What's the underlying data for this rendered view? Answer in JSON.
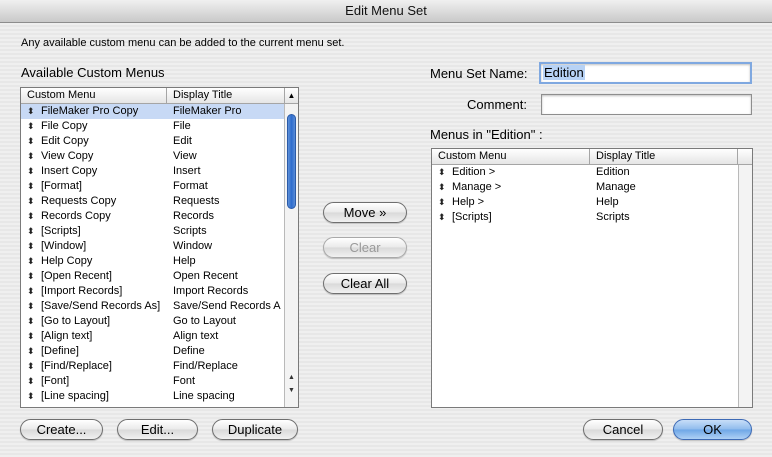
{
  "window": {
    "title": "Edit Menu Set"
  },
  "intro_text": "Any available custom menu can be added to the current menu set.",
  "available": {
    "heading": "Available Custom Menus",
    "columns": [
      "Custom Menu",
      "Display Title"
    ],
    "sort_indicator": "▲",
    "rows": [
      {
        "menu": "FileMaker Pro Copy",
        "title": "FileMaker Pro",
        "selected": true
      },
      {
        "menu": "File Copy",
        "title": "File"
      },
      {
        "menu": "Edit Copy",
        "title": "Edit"
      },
      {
        "menu": "View Copy",
        "title": "View"
      },
      {
        "menu": "Insert Copy",
        "title": "Insert"
      },
      {
        "menu": "[Format]",
        "title": "Format"
      },
      {
        "menu": "Requests Copy",
        "title": "Requests"
      },
      {
        "menu": "Records Copy",
        "title": "Records"
      },
      {
        "menu": "[Scripts]",
        "title": "Scripts"
      },
      {
        "menu": "[Window]",
        "title": "Window"
      },
      {
        "menu": "Help Copy",
        "title": "Help"
      },
      {
        "menu": "[Open Recent]",
        "title": "Open Recent"
      },
      {
        "menu": "[Import Records]",
        "title": "Import Records"
      },
      {
        "menu": "[Save/Send Records As]",
        "title": "Save/Send Records A"
      },
      {
        "menu": "[Go to Layout]",
        "title": "Go to Layout"
      },
      {
        "menu": "[Align text]",
        "title": "Align text"
      },
      {
        "menu": "[Define]",
        "title": "Define"
      },
      {
        "menu": "[Find/Replace]",
        "title": "Find/Replace"
      },
      {
        "menu": "[Font]",
        "title": "Font"
      },
      {
        "menu": "[Line spacing]",
        "title": "Line spacing"
      }
    ]
  },
  "menu_set_name": {
    "label": "Menu Set Name:",
    "value": "Edition"
  },
  "comment": {
    "label": "Comment:",
    "value": ""
  },
  "menus_in": {
    "heading": "Menus in \"Edition\" :",
    "columns": [
      "Custom Menu",
      "Display Title"
    ],
    "rows": [
      {
        "menu": "Edition >",
        "title": "Edition"
      },
      {
        "menu": "Manage >",
        "title": "Manage"
      },
      {
        "menu": "Help >",
        "title": "Help"
      },
      {
        "menu": "[Scripts]",
        "title": "Scripts"
      }
    ]
  },
  "buttons": {
    "move": "Move »",
    "clear": "Clear",
    "clear_all": "Clear All",
    "create": "Create...",
    "edit": "Edit...",
    "duplicate": "Duplicate",
    "cancel": "Cancel",
    "ok": "OK"
  },
  "icons": {
    "row_handle": "up-down-arrow-icon",
    "sort": "sort-ascending-icon"
  },
  "colors": {
    "selection": "#c7d9f5",
    "scroll_thumb": "#2d6ccd",
    "focus_ring": "#7fa8e0",
    "default_button": "#6ea6e6"
  }
}
